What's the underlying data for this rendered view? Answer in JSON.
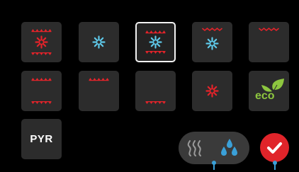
{
  "mode_tiles": [
    {
      "name": "top-bottom-fan-heat",
      "icons": [
        "top-heat",
        "fan",
        "bottom-heat"
      ]
    },
    {
      "name": "fan-only",
      "icons": [
        "fan"
      ]
    },
    {
      "name": "top-bottom-fan-heat-selected",
      "icons": [
        "top-heat",
        "fan",
        "bottom-heat"
      ],
      "selected": true
    },
    {
      "name": "grill-fan",
      "icons": [
        "grill",
        "fan"
      ]
    },
    {
      "name": "grill",
      "icons": [
        "grill"
      ]
    },
    {
      "name": "top-bottom-heat",
      "icons": [
        "top-heat",
        "bottom-heat"
      ]
    },
    {
      "name": "top-heat",
      "icons": [
        "top-heat"
      ]
    },
    {
      "name": "bottom-heat",
      "icons": [
        "bottom-heat"
      ]
    },
    {
      "name": "ring-heat",
      "icons": [
        "ring-heat"
      ]
    },
    {
      "name": "eco",
      "icons": [
        "eco-leaf"
      ]
    }
  ],
  "pyr": {
    "label": "PYR"
  },
  "eco": {
    "label": "eco"
  },
  "steam_pill": {
    "icons": [
      "steam-icon",
      "water-drops-icon"
    ]
  },
  "confirm": {
    "icon": "checkmark-icon"
  },
  "colors": {
    "heat": "#e3232a",
    "fan": "#5ec8e8",
    "accent_red": "#e0242a",
    "indicator_blue": "#3aa0d8",
    "eco_green": "#8dc63f"
  }
}
